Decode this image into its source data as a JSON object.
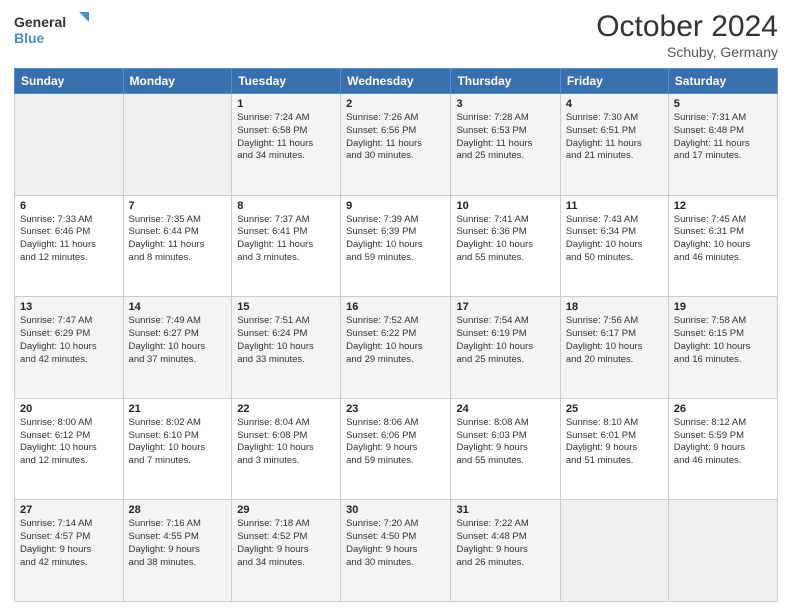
{
  "header": {
    "title": "October 2024",
    "location": "Schuby, Germany"
  },
  "columns": [
    "Sunday",
    "Monday",
    "Tuesday",
    "Wednesday",
    "Thursday",
    "Friday",
    "Saturday"
  ],
  "weeks": [
    [
      {
        "day": "",
        "info": ""
      },
      {
        "day": "",
        "info": ""
      },
      {
        "day": "1",
        "info": "Sunrise: 7:24 AM\nSunset: 6:58 PM\nDaylight: 11 hours\nand 34 minutes."
      },
      {
        "day": "2",
        "info": "Sunrise: 7:26 AM\nSunset: 6:56 PM\nDaylight: 11 hours\nand 30 minutes."
      },
      {
        "day": "3",
        "info": "Sunrise: 7:28 AM\nSunset: 6:53 PM\nDaylight: 11 hours\nand 25 minutes."
      },
      {
        "day": "4",
        "info": "Sunrise: 7:30 AM\nSunset: 6:51 PM\nDaylight: 11 hours\nand 21 minutes."
      },
      {
        "day": "5",
        "info": "Sunrise: 7:31 AM\nSunset: 6:48 PM\nDaylight: 11 hours\nand 17 minutes."
      }
    ],
    [
      {
        "day": "6",
        "info": "Sunrise: 7:33 AM\nSunset: 6:46 PM\nDaylight: 11 hours\nand 12 minutes."
      },
      {
        "day": "7",
        "info": "Sunrise: 7:35 AM\nSunset: 6:44 PM\nDaylight: 11 hours\nand 8 minutes."
      },
      {
        "day": "8",
        "info": "Sunrise: 7:37 AM\nSunset: 6:41 PM\nDaylight: 11 hours\nand 3 minutes."
      },
      {
        "day": "9",
        "info": "Sunrise: 7:39 AM\nSunset: 6:39 PM\nDaylight: 10 hours\nand 59 minutes."
      },
      {
        "day": "10",
        "info": "Sunrise: 7:41 AM\nSunset: 6:36 PM\nDaylight: 10 hours\nand 55 minutes."
      },
      {
        "day": "11",
        "info": "Sunrise: 7:43 AM\nSunset: 6:34 PM\nDaylight: 10 hours\nand 50 minutes."
      },
      {
        "day": "12",
        "info": "Sunrise: 7:45 AM\nSunset: 6:31 PM\nDaylight: 10 hours\nand 46 minutes."
      }
    ],
    [
      {
        "day": "13",
        "info": "Sunrise: 7:47 AM\nSunset: 6:29 PM\nDaylight: 10 hours\nand 42 minutes."
      },
      {
        "day": "14",
        "info": "Sunrise: 7:49 AM\nSunset: 6:27 PM\nDaylight: 10 hours\nand 37 minutes."
      },
      {
        "day": "15",
        "info": "Sunrise: 7:51 AM\nSunset: 6:24 PM\nDaylight: 10 hours\nand 33 minutes."
      },
      {
        "day": "16",
        "info": "Sunrise: 7:52 AM\nSunset: 6:22 PM\nDaylight: 10 hours\nand 29 minutes."
      },
      {
        "day": "17",
        "info": "Sunrise: 7:54 AM\nSunset: 6:19 PM\nDaylight: 10 hours\nand 25 minutes."
      },
      {
        "day": "18",
        "info": "Sunrise: 7:56 AM\nSunset: 6:17 PM\nDaylight: 10 hours\nand 20 minutes."
      },
      {
        "day": "19",
        "info": "Sunrise: 7:58 AM\nSunset: 6:15 PM\nDaylight: 10 hours\nand 16 minutes."
      }
    ],
    [
      {
        "day": "20",
        "info": "Sunrise: 8:00 AM\nSunset: 6:12 PM\nDaylight: 10 hours\nand 12 minutes."
      },
      {
        "day": "21",
        "info": "Sunrise: 8:02 AM\nSunset: 6:10 PM\nDaylight: 10 hours\nand 7 minutes."
      },
      {
        "day": "22",
        "info": "Sunrise: 8:04 AM\nSunset: 6:08 PM\nDaylight: 10 hours\nand 3 minutes."
      },
      {
        "day": "23",
        "info": "Sunrise: 8:06 AM\nSunset: 6:06 PM\nDaylight: 9 hours\nand 59 minutes."
      },
      {
        "day": "24",
        "info": "Sunrise: 8:08 AM\nSunset: 6:03 PM\nDaylight: 9 hours\nand 55 minutes."
      },
      {
        "day": "25",
        "info": "Sunrise: 8:10 AM\nSunset: 6:01 PM\nDaylight: 9 hours\nand 51 minutes."
      },
      {
        "day": "26",
        "info": "Sunrise: 8:12 AM\nSunset: 5:59 PM\nDaylight: 9 hours\nand 46 minutes."
      }
    ],
    [
      {
        "day": "27",
        "info": "Sunrise: 7:14 AM\nSunset: 4:57 PM\nDaylight: 9 hours\nand 42 minutes."
      },
      {
        "day": "28",
        "info": "Sunrise: 7:16 AM\nSunset: 4:55 PM\nDaylight: 9 hours\nand 38 minutes."
      },
      {
        "day": "29",
        "info": "Sunrise: 7:18 AM\nSunset: 4:52 PM\nDaylight: 9 hours\nand 34 minutes."
      },
      {
        "day": "30",
        "info": "Sunrise: 7:20 AM\nSunset: 4:50 PM\nDaylight: 9 hours\nand 30 minutes."
      },
      {
        "day": "31",
        "info": "Sunrise: 7:22 AM\nSunset: 4:48 PM\nDaylight: 9 hours\nand 26 minutes."
      },
      {
        "day": "",
        "info": ""
      },
      {
        "day": "",
        "info": ""
      }
    ]
  ]
}
